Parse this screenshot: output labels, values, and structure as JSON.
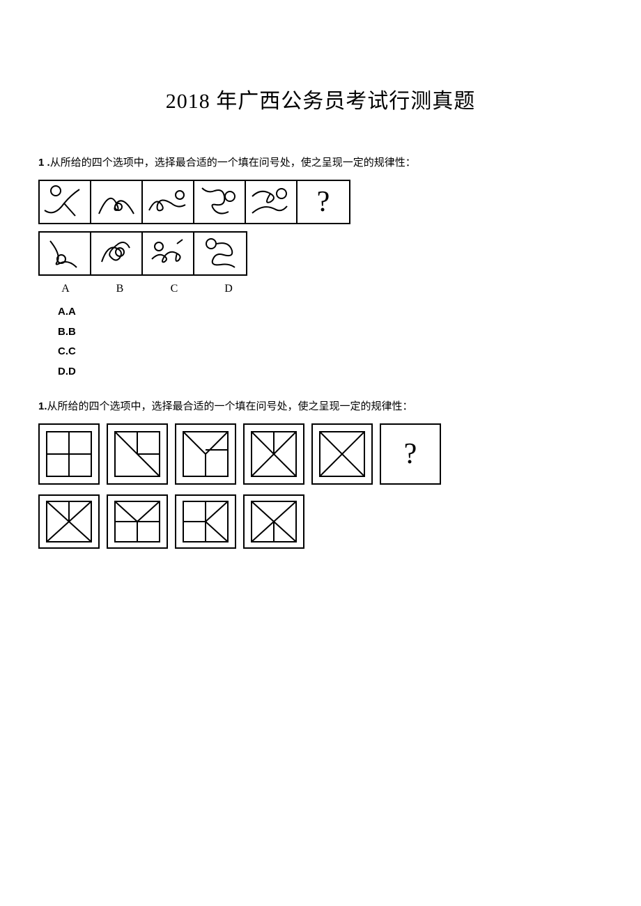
{
  "title": "2018 年广西公务员考试行测真题",
  "q1": {
    "number": "1 .",
    "text": "从所给的四个选项中，选择最合适的一个填在问号处，使之呈现一定的规律性：",
    "answerLabels": [
      "A",
      "B",
      "C",
      "D"
    ],
    "options": [
      "A.A",
      "B.B",
      "C.C",
      "D.D"
    ]
  },
  "q2": {
    "number": "1.",
    "text": "从所给的四个选项中，选择最合适的一个填在问号处，使之呈现一定的规律性："
  },
  "qmark": "?"
}
